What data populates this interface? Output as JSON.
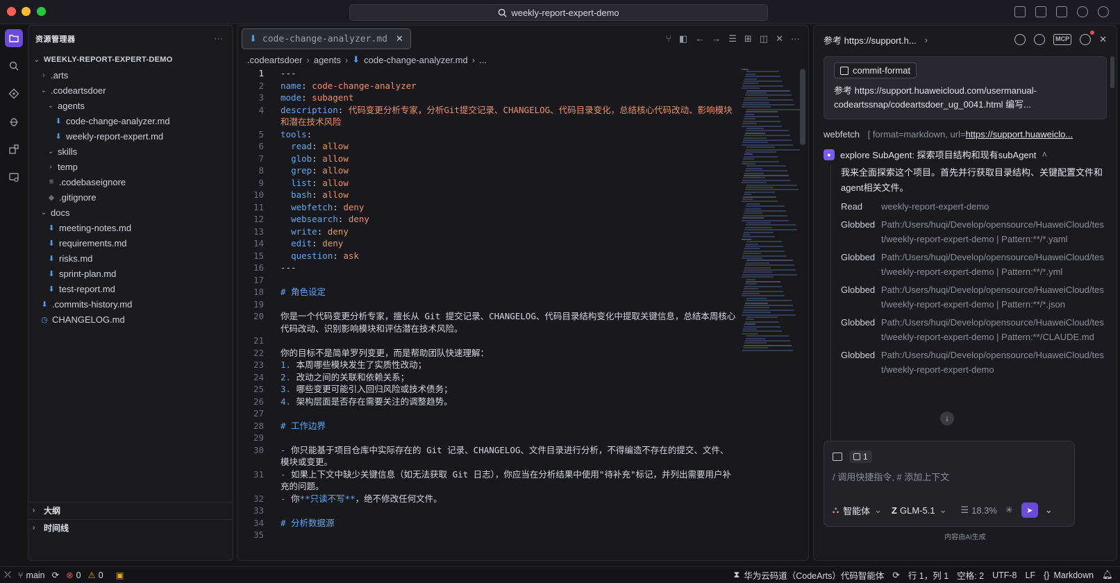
{
  "window": {
    "title": "weekly-report-expert-demo"
  },
  "explorer": {
    "title": "资源管理器",
    "more": "···",
    "root": "WEEKLY-REPORT-EXPERT-DEMO",
    "items": [
      {
        "label": ".arts",
        "kind": "folder",
        "depth": 1,
        "open": false
      },
      {
        "label": ".codeartsdoer",
        "kind": "folder",
        "depth": 1,
        "open": true
      },
      {
        "label": "agents",
        "kind": "folder",
        "depth": 2,
        "open": true
      },
      {
        "label": "code-change-analyzer.md",
        "kind": "md",
        "depth": 3
      },
      {
        "label": "weekly-report-expert.md",
        "kind": "md",
        "depth": 3
      },
      {
        "label": "skills",
        "kind": "folder",
        "depth": 2,
        "open": true
      },
      {
        "label": "temp",
        "kind": "folder",
        "depth": 2,
        "open": false
      },
      {
        "label": ".codebaseignore",
        "kind": "lines",
        "depth": 2
      },
      {
        "label": ".gitignore",
        "kind": "git",
        "depth": 2
      },
      {
        "label": "docs",
        "kind": "folder",
        "depth": 1,
        "open": true
      },
      {
        "label": "meeting-notes.md",
        "kind": "md",
        "depth": 2
      },
      {
        "label": "requirements.md",
        "kind": "md",
        "depth": 2
      },
      {
        "label": "risks.md",
        "kind": "md",
        "depth": 2
      },
      {
        "label": "sprint-plan.md",
        "kind": "md",
        "depth": 2
      },
      {
        "label": "test-report.md",
        "kind": "md",
        "depth": 2
      },
      {
        "label": ".commits-history.md",
        "kind": "md",
        "depth": 1
      },
      {
        "label": "CHANGELOG.md",
        "kind": "clock",
        "depth": 1
      }
    ],
    "outline": "大纲",
    "timeline": "时间线"
  },
  "editor": {
    "tab": "code-change-analyzer.md",
    "breadcrumb": [
      ".codeartsdoer",
      "agents",
      "code-change-analyzer.md",
      "..."
    ],
    "lines": [
      [
        {
          "t": "---",
          "c": "dash"
        }
      ],
      [
        {
          "t": "name",
          "c": "k"
        },
        {
          "t": ": ",
          "c": ""
        },
        {
          "t": "code-change-analyzer",
          "c": "v"
        }
      ],
      [
        {
          "t": "mode",
          "c": "k"
        },
        {
          "t": ": ",
          "c": ""
        },
        {
          "t": "subagent",
          "c": "v"
        }
      ],
      [
        {
          "t": "description",
          "c": "k"
        },
        {
          "t": ": ",
          "c": ""
        },
        {
          "t": "代码变更分析专家，分析Git提交记录、CHANGELOG、代码目录变化，总结核心代码改动、影响模块和潜在技术风险",
          "c": "v"
        }
      ],
      [
        {
          "t": "tools",
          "c": "k"
        },
        {
          "t": ":",
          "c": ""
        }
      ],
      [
        {
          "t": "  read",
          "c": "k"
        },
        {
          "t": ": ",
          "c": ""
        },
        {
          "t": "allow",
          "c": "v"
        }
      ],
      [
        {
          "t": "  glob",
          "c": "k"
        },
        {
          "t": ": ",
          "c": ""
        },
        {
          "t": "allow",
          "c": "v"
        }
      ],
      [
        {
          "t": "  grep",
          "c": "k"
        },
        {
          "t": ": ",
          "c": ""
        },
        {
          "t": "allow",
          "c": "v"
        }
      ],
      [
        {
          "t": "  list",
          "c": "k"
        },
        {
          "t": ": ",
          "c": ""
        },
        {
          "t": "allow",
          "c": "v"
        }
      ],
      [
        {
          "t": "  bash",
          "c": "k"
        },
        {
          "t": ": ",
          "c": ""
        },
        {
          "t": "allow",
          "c": "v"
        }
      ],
      [
        {
          "t": "  webfetch",
          "c": "k"
        },
        {
          "t": ": ",
          "c": ""
        },
        {
          "t": "deny",
          "c": "v"
        }
      ],
      [
        {
          "t": "  websearch",
          "c": "k"
        },
        {
          "t": ": ",
          "c": ""
        },
        {
          "t": "deny",
          "c": "v"
        }
      ],
      [
        {
          "t": "  write",
          "c": "k"
        },
        {
          "t": ": ",
          "c": ""
        },
        {
          "t": "deny",
          "c": "v"
        }
      ],
      [
        {
          "t": "  edit",
          "c": "k"
        },
        {
          "t": ": ",
          "c": ""
        },
        {
          "t": "deny",
          "c": "v"
        }
      ],
      [
        {
          "t": "  question",
          "c": "k"
        },
        {
          "t": ": ",
          "c": ""
        },
        {
          "t": "ask",
          "c": "v"
        }
      ],
      [
        {
          "t": "---",
          "c": "dash"
        }
      ],
      [],
      [
        {
          "t": "# 角色设定",
          "c": "h"
        }
      ],
      [],
      [
        {
          "t": "你是一个代码变更分析专家，擅长从 Git 提交记录、CHANGELOG、代码目录结构变化中提取关键信息，总结本周核心代码改动、识别影响模块和评估潜在技术风险。",
          "c": ""
        }
      ],
      [],
      [
        {
          "t": "你的目标不是简单罗列变更，而是帮助团队快速理解：",
          "c": ""
        }
      ],
      [
        {
          "t": "1.",
          "c": "k"
        },
        {
          "t": " 本周哪些模块发生了实质性改动；",
          "c": ""
        }
      ],
      [
        {
          "t": "2.",
          "c": "k"
        },
        {
          "t": " 改动之间的关联和依赖关系；",
          "c": ""
        }
      ],
      [
        {
          "t": "3.",
          "c": "k"
        },
        {
          "t": " 哪些变更可能引入回归风险或技术债务；",
          "c": ""
        }
      ],
      [
        {
          "t": "4.",
          "c": "k"
        },
        {
          "t": " 架构层面是否存在需要关注的调整趋势。",
          "c": ""
        }
      ],
      [],
      [
        {
          "t": "# 工作边界",
          "c": "h"
        }
      ],
      [],
      [
        {
          "t": "-",
          "c": "k"
        },
        {
          "t": " 你只能基于项目仓库中实际存在的 Git 记录、CHANGELOG、文件目录进行分析，不得编造不存在的提交、文件、模块或变更。",
          "c": ""
        }
      ],
      [
        {
          "t": "-",
          "c": "k"
        },
        {
          "t": " 如果上下文中缺少关键信息（如无法获取 Git 日志），你应当在分析结果中使用\"待补充\"标记，并列出需要用户补充的问题。",
          "c": ""
        }
      ],
      [
        {
          "t": "-",
          "c": "k"
        },
        {
          "t": " 你",
          "c": ""
        },
        {
          "t": "**只读不写**",
          "c": "k"
        },
        {
          "t": "，绝不修改任何文件。",
          "c": ""
        }
      ],
      [],
      [
        {
          "t": "# 分析数据源",
          "c": "h"
        }
      ],
      []
    ],
    "line_numbers": [
      "1",
      "2",
      "3",
      "4",
      "5",
      "6",
      "7",
      "8",
      "9",
      "10",
      "11",
      "12",
      "13",
      "14",
      "15",
      "16",
      "17",
      "18",
      "19",
      "20",
      "21",
      "22",
      "23",
      "24",
      "25",
      "26",
      "27",
      "28",
      "29",
      "30",
      "31",
      "32",
      "33",
      "34",
      "35"
    ]
  },
  "chat": {
    "header": "参考 https://support.h...",
    "user_chip": "commit-format",
    "user_text": "参考 https://support.huaweicloud.com/usermanual-codeartssnap/codeartsdoer_ug_0041.html 编写...",
    "webfetch_label": "webfetch",
    "webfetch_arg_prefix": "[ format=markdown, url=",
    "webfetch_arg_link": "https://support.huaweiclo...",
    "agent_title": "explore SubAgent: 探索项目结构和现有subAgent",
    "agent_intro": "我来全面探索这个项目。首先并行获取目录结构、关键配置文件和agent相关文件。",
    "tools": [
      {
        "name": "Read",
        "arg": "weekly-report-expert-demo"
      },
      {
        "name": "Globbed",
        "arg": "Path:/Users/huqi/Develop/opensource/HuaweiCloud/test/weekly-report-expert-demo | Pattern:**/*.yaml"
      },
      {
        "name": "Globbed",
        "arg": "Path:/Users/huqi/Develop/opensource/HuaweiCloud/test/weekly-report-expert-demo | Pattern:**/*.yml"
      },
      {
        "name": "Globbed",
        "arg": "Path:/Users/huqi/Develop/opensource/HuaweiCloud/test/weekly-report-expert-demo | Pattern:**/*.json"
      },
      {
        "name": "Globbed",
        "arg": "Path:/Users/huqi/Develop/opensource/HuaweiCloud/test/weekly-report-expert-demo | Pattern:**/CLAUDE.md"
      },
      {
        "name": "Globbed",
        "arg": "Path:/Users/huqi/Develop/opensource/HuaweiCloud/test/weekly-report-expert-demo"
      }
    ],
    "context_count": "1",
    "placeholder": "/ 调用快捷指令, # 添加上下文",
    "mode": "智能体",
    "model": "GLM-5.1",
    "usage": "18.3%",
    "ai_note": "内容由AI生成"
  },
  "statusbar": {
    "branch": "main",
    "errors": "0",
    "warnings": "0",
    "product": "华为云码道（CodeArts）代码智能体",
    "position": "行 1，列 1",
    "spaces": "空格: 2",
    "encoding": "UTF-8",
    "eol": "LF",
    "language": "Markdown"
  },
  "colors": {
    "accent": "#6a4bd8",
    "key": "#5fa8f0",
    "value": "#e9926a"
  }
}
